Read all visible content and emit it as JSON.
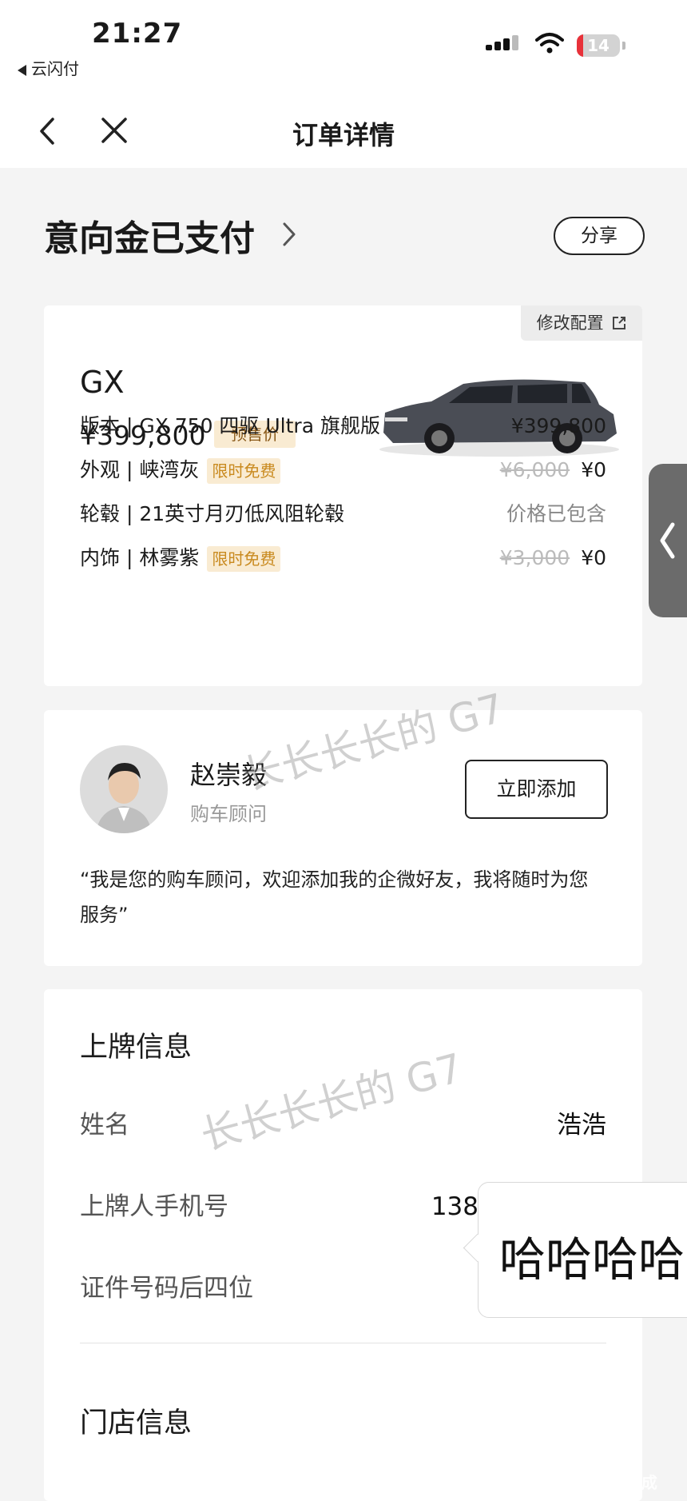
{
  "status_bar": {
    "time": "21:27",
    "back_app": "云闪付",
    "battery": "14",
    "battery_level": 0.14
  },
  "nav": {
    "title": "订单详情"
  },
  "order": {
    "status": "意向金已支付",
    "share": "分享"
  },
  "car": {
    "modify": "修改配置",
    "model": "GX",
    "price": "¥399,800",
    "price_tag": "预售价",
    "config": [
      {
        "label": "版本 | GX 750 四驱 Ultra 旗舰版",
        "tag": "",
        "original": "",
        "value": "¥399,800"
      },
      {
        "label": "外观 | 峡湾灰",
        "tag": "限时免费",
        "original": "¥6,000",
        "value": "¥0"
      },
      {
        "label": "轮毂 | 21英寸月刃低风阻轮毂",
        "tag": "",
        "original": "",
        "value": "价格已包含"
      },
      {
        "label": "内饰 | 林雾紫",
        "tag": "限时免费",
        "original": "¥3,000",
        "value": "¥0"
      }
    ]
  },
  "advisor": {
    "name": "赵崇毅",
    "role": "购车顾问",
    "add_button": "立即添加",
    "quote": "“我是您的购车顾问，欢迎添加我的企微好友，我将随时为您服务”"
  },
  "registration": {
    "title": "上牌信息",
    "rows": [
      {
        "label": "姓名",
        "value": "浩浩"
      },
      {
        "label": "上牌人手机号",
        "value": "138"
      },
      {
        "label": "证件号码后四位",
        "value": ""
      }
    ]
  },
  "store": {
    "title": "门店信息"
  },
  "overlay": {
    "bubble_text": "哈哈哈哈",
    "watermark": "长长长长的 G7",
    "corner_mark": "豆包AI生成"
  },
  "colors": {
    "tag_bg": "#f9ebd2",
    "tag_text": "#c98a1f",
    "battery_low": "#e8323a"
  }
}
